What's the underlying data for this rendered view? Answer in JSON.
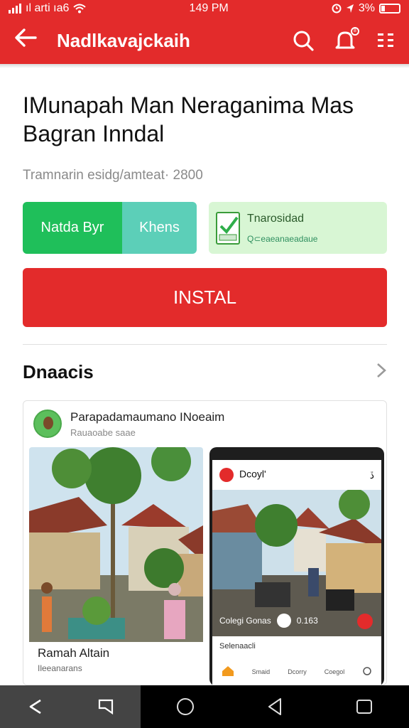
{
  "status": {
    "carrier": "ıl arti ıa6",
    "time": "149 PM",
    "battery": "3%"
  },
  "appbar": {
    "title": "Nadlkavajckaih",
    "notification_count": "8"
  },
  "app": {
    "title": "IMunapah Man Neraganima Mas Bagran Inndal",
    "meta": "Tramnarin esidg/amteat· 2800",
    "tag_primary": "Natda Byr",
    "tag_secondary": "Khens",
    "badge_title": "Tnarosidad",
    "badge_sub": "Q⊂eaeanaeadaue",
    "install_label": "INSTAL"
  },
  "section": {
    "heading": "Dnaacis"
  },
  "card": {
    "developer_name": "Parapadamaumano INoeaim",
    "developer_sub": "Rauaoabe saae",
    "shot1_caption": "Ramah Altain",
    "shot1_sub": "Ileeanarans",
    "shot2_header": "Dcoyl'",
    "shot2_close": "ڏ",
    "shot2_overlay_left": "Colegi Gonas",
    "shot2_overlay_num": "0.163",
    "shot2_sub": "Selenaacli",
    "shot2_nav": [
      "",
      "Smaid",
      "Dcorry",
      "Coegol",
      ""
    ]
  },
  "colors": {
    "brand": "#e32b2b",
    "green": "#1fbf5a",
    "teal": "#5ccfb8",
    "badge_bg": "#d8f6d4"
  }
}
